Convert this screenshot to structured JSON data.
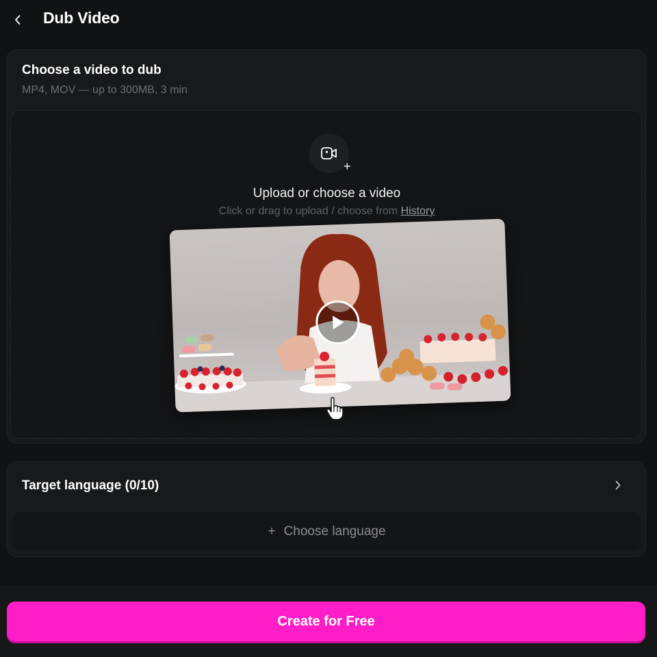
{
  "header": {
    "title": "Dub Video",
    "back_icon": "chevron-left-icon"
  },
  "video_section": {
    "title": "Choose a video to dub",
    "subtitle": "MP4, MOV — up to 300MB, 3 min",
    "dropzone": {
      "icon": "video-camera-icon",
      "plus": "+",
      "title": "Upload or choose a video",
      "hint_prefix": "Click or drag to upload / choose from ",
      "hint_link": "History"
    },
    "preview": {
      "play_icon": "play-icon"
    }
  },
  "language_section": {
    "title": "Target language (0/10)",
    "chevron_icon": "chevron-right-icon",
    "choose_plus": "+",
    "choose_label": "Choose language"
  },
  "footer": {
    "create_label": "Create for Free"
  },
  "colors": {
    "background": "#111213",
    "card": "#18191a",
    "accent": "#ff1dc7"
  }
}
